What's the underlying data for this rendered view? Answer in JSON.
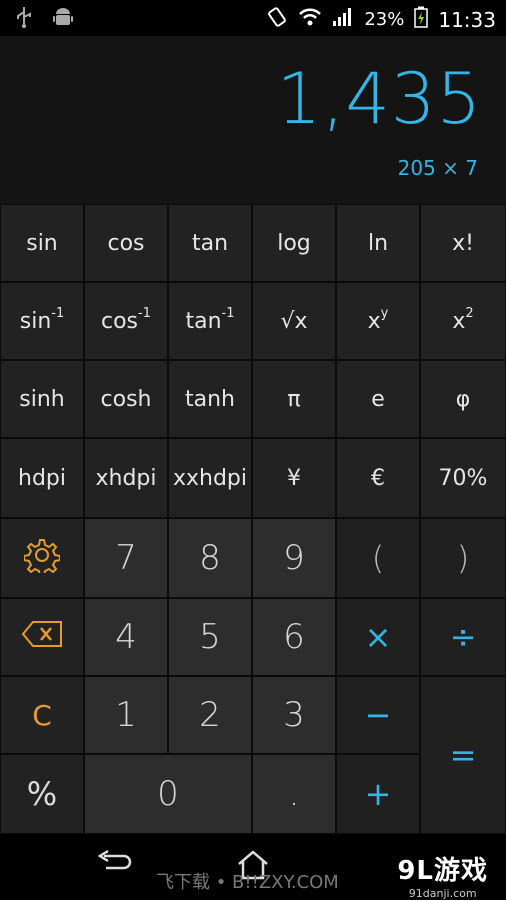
{
  "status": {
    "battery": "23%",
    "time": "11:33",
    "icons": [
      "usb-icon",
      "android-icon",
      "vibrate-icon",
      "wifi-icon",
      "signal-icon",
      "battery-charging-icon"
    ]
  },
  "display": {
    "result": "1,435",
    "expression": "205 × 7"
  },
  "keys": {
    "r1": [
      "sin",
      "cos",
      "tan",
      "log",
      "ln",
      "x!"
    ],
    "r2": [
      {
        "base": "sin",
        "sup": "-1"
      },
      {
        "base": "cos",
        "sup": "-1"
      },
      {
        "base": "tan",
        "sup": "-1"
      },
      {
        "base": "√x",
        "sup": ""
      },
      {
        "base": "x",
        "sup": "y"
      },
      {
        "base": "x",
        "sup": "2"
      }
    ],
    "r3": [
      "sinh",
      "cosh",
      "tanh",
      "π",
      "e",
      "φ"
    ],
    "r4": [
      "hdpi",
      "xhdpi",
      "xxhdpi",
      "¥",
      "€",
      "70%"
    ],
    "digits": {
      "d7": "7",
      "d8": "8",
      "d9": "9",
      "d4": "4",
      "d5": "5",
      "d6": "6",
      "d1": "1",
      "d2": "2",
      "d3": "3",
      "d0": "0",
      "dot": "."
    },
    "paren_open": "(",
    "paren_close": ")",
    "multiply": "×",
    "divide": "÷",
    "minus": "−",
    "plus": "+",
    "equals": "=",
    "clear": "C",
    "percent": "%"
  },
  "colors": {
    "accent": "#33b5e5",
    "orange": "#e69b2a"
  },
  "watermark": {
    "left": "飞下载 • B!!ZXY.COM",
    "right_big": "9L游戏",
    "right_small": "91danji.com"
  }
}
